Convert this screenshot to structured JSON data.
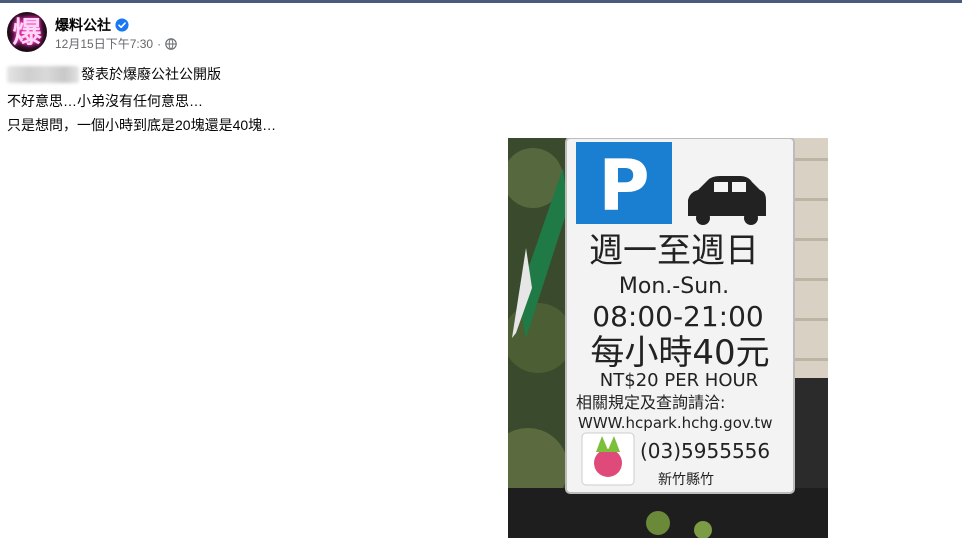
{
  "header": {
    "avatar_glyph": "爆",
    "page_name": "爆料公社",
    "verified_icon": "verified-badge-icon",
    "timestamp": "12月15日下午7:30",
    "separator": "·",
    "audience_icon": "globe-icon"
  },
  "post": {
    "line1_suffix": "發表於爆廢公社公開版",
    "line2": "不好意思…小弟沒有任何意思…",
    "line3": "只是想問，一個小時到底是20塊還是40塊…"
  },
  "photo": {
    "sign": {
      "parking_letter": "P",
      "days": "週一至週日",
      "days_en": "Mon.-Sun.",
      "hours": "08:00-21:00",
      "rate_zh": "每小時40元",
      "rate_en": "NT$20 PER HOUR",
      "inquiry": "相關規定及查詢請洽:",
      "website": "WWW.hcpark.hchg.gov.tw",
      "phone": "(03)5955556",
      "issuer": "新竹縣竹"
    }
  },
  "colors": {
    "verified_blue": "#1877f2",
    "secondary_text": "#65676b",
    "parking_blue": "#1a7fd0"
  }
}
